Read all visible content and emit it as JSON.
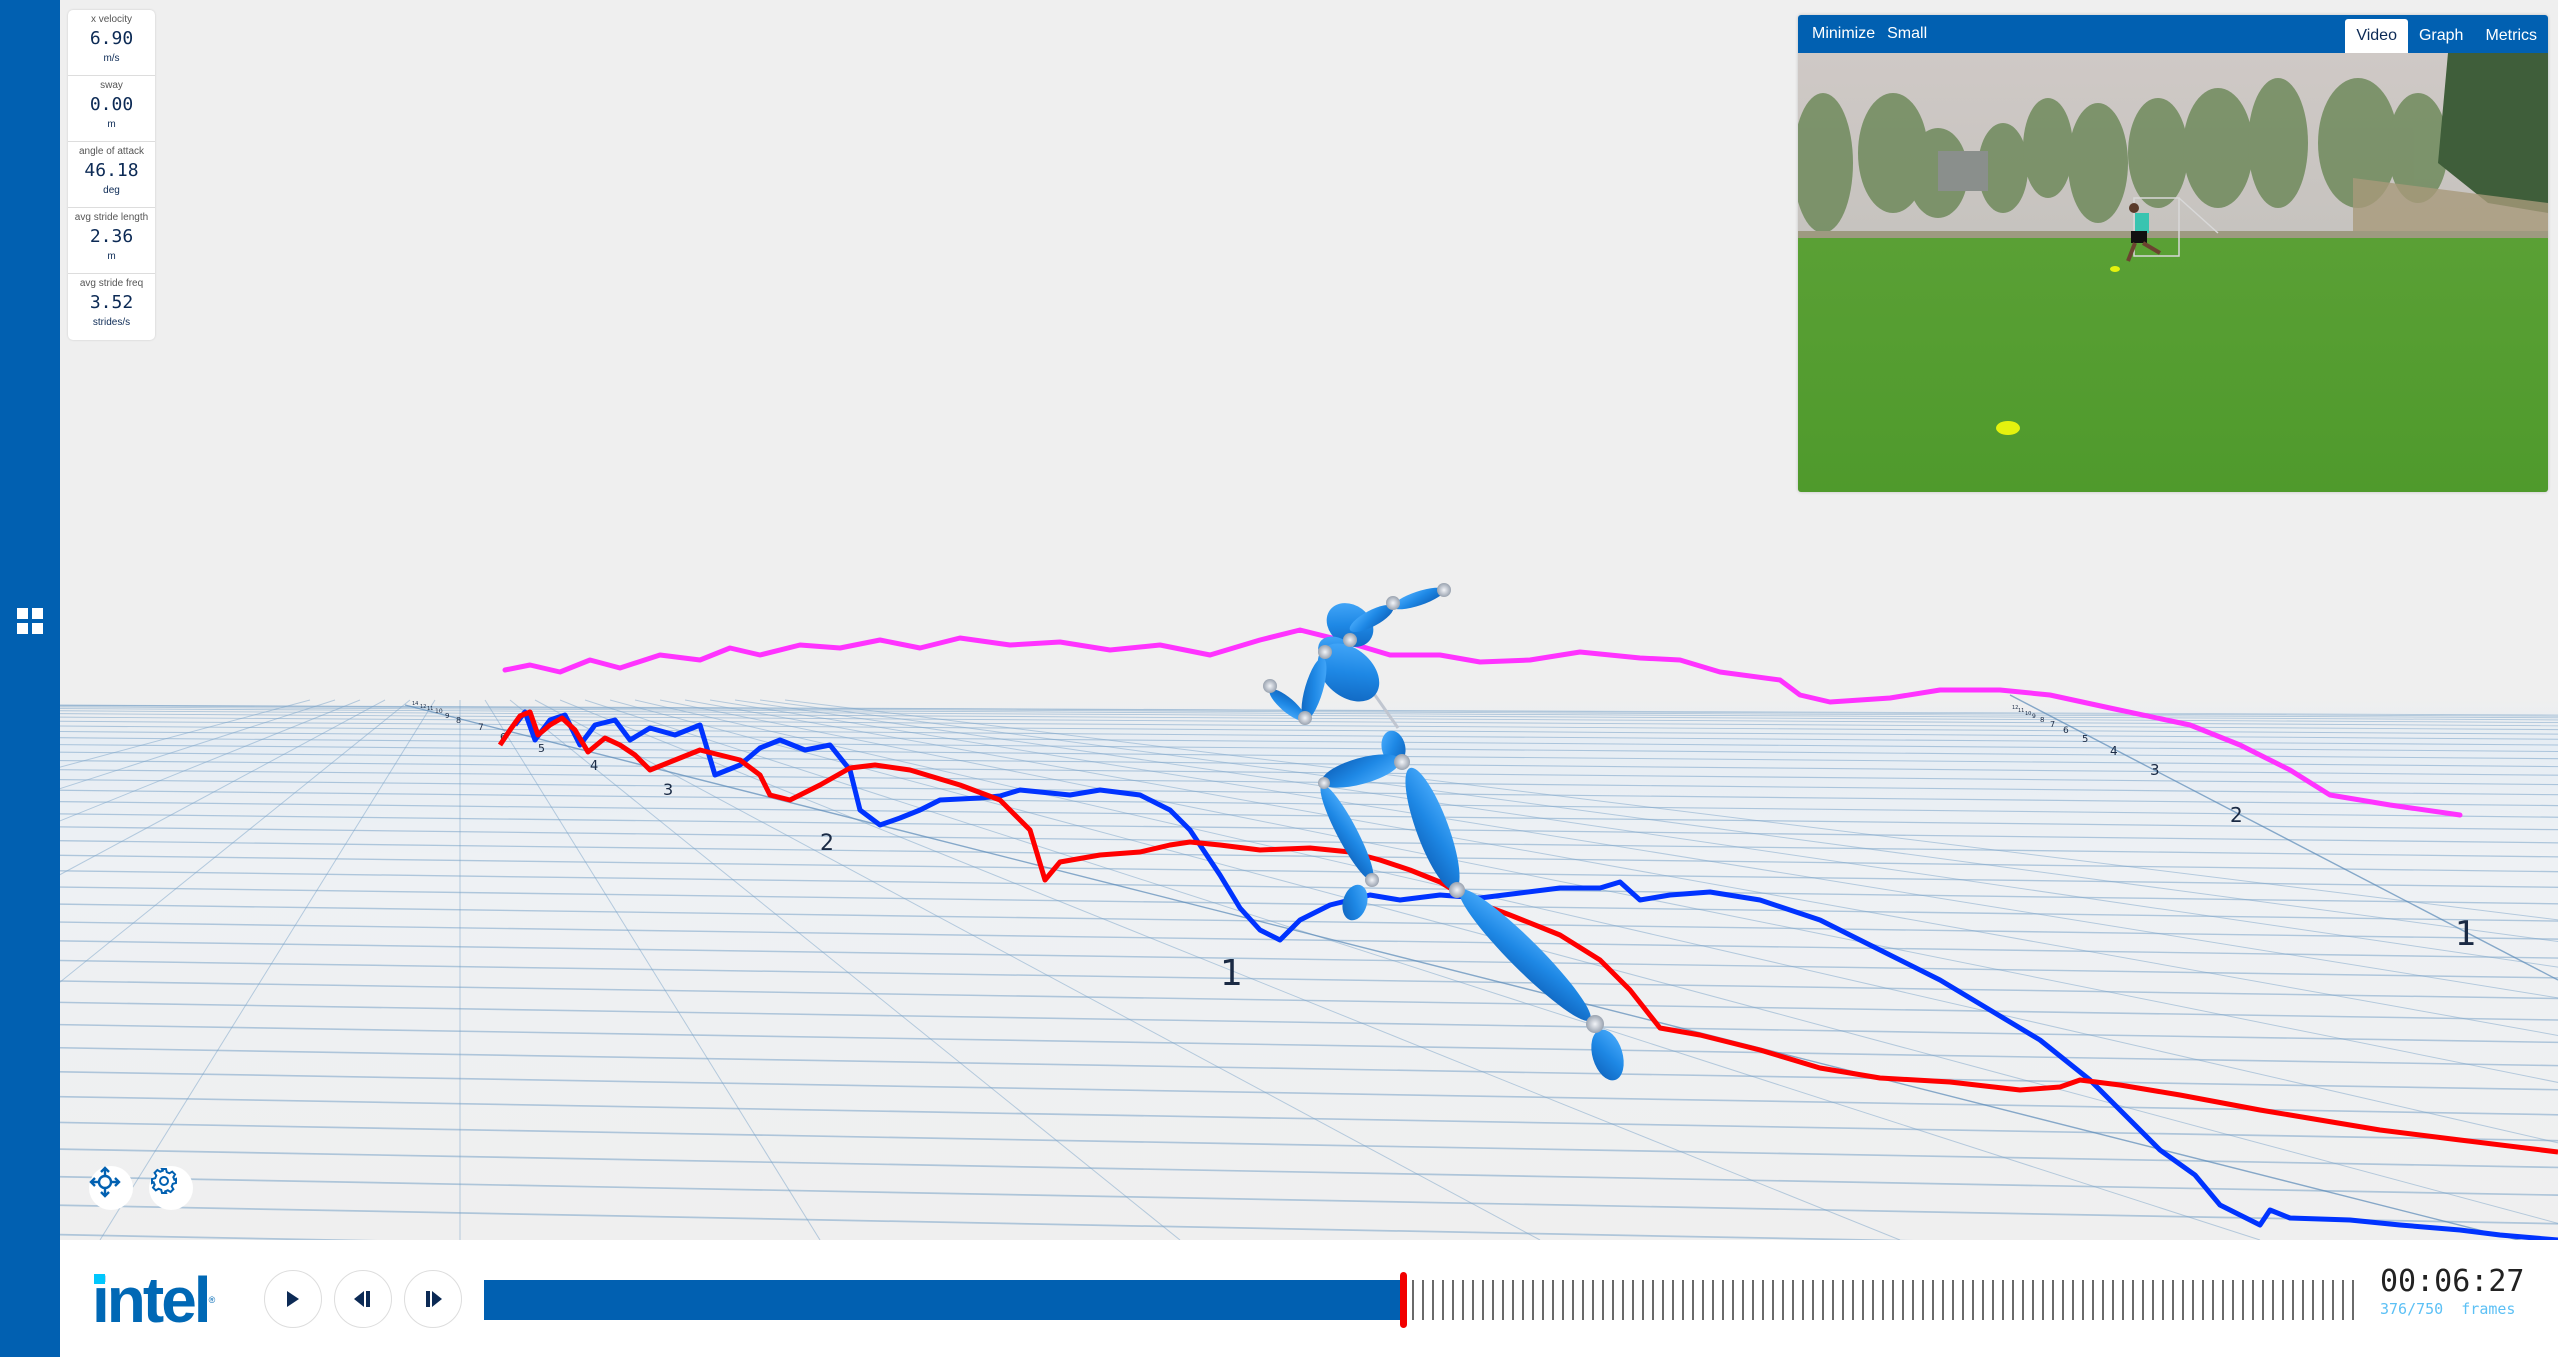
{
  "sidebar": {
    "menu_icon": "grid-icon"
  },
  "metrics": [
    {
      "label": "x velocity",
      "value": "6.90",
      "unit": "m/s"
    },
    {
      "label": "sway",
      "value": "0.00",
      "unit": "m"
    },
    {
      "label": "angle of attack",
      "value": "46.18",
      "unit": "deg"
    },
    {
      "label": "avg stride length",
      "value": "2.36",
      "unit": "m"
    },
    {
      "label": "avg stride freq",
      "value": "3.52",
      "unit": "strides/s"
    }
  ],
  "video_panel": {
    "buttons": [
      "Minimize",
      "Small"
    ],
    "tabs": [
      {
        "label": "Video",
        "active": true
      },
      {
        "label": "Graph",
        "active": false
      },
      {
        "label": "Metrics",
        "active": false
      }
    ]
  },
  "scene": {
    "left_axis_labels": [
      "1",
      "2",
      "3",
      "4",
      "5",
      "6",
      "7",
      "8",
      "9",
      "10",
      "11",
      "12",
      "14"
    ],
    "right_axis_labels": [
      "1",
      "2",
      "3",
      "4",
      "5",
      "6",
      "7",
      "8",
      "9",
      "10",
      "11",
      "12"
    ],
    "trace_colors": {
      "left_foot": "#ff0000",
      "right_foot": "#0033ff",
      "head": "#ff33ff"
    },
    "skeleton_color": "#1e88e5",
    "joint_color": "#c0c6d0",
    "grid_color": "#7aa3c8",
    "tools": [
      "move-icon",
      "settings-icon"
    ]
  },
  "player": {
    "logo": "intel",
    "controls": [
      "play",
      "step-back",
      "step-forward"
    ],
    "current_frame": 376,
    "total_frames": 750,
    "time": "00:06:27",
    "frames_label": "376/750  frames",
    "accent": "#0160b1",
    "playhead_color": "#f20000"
  }
}
